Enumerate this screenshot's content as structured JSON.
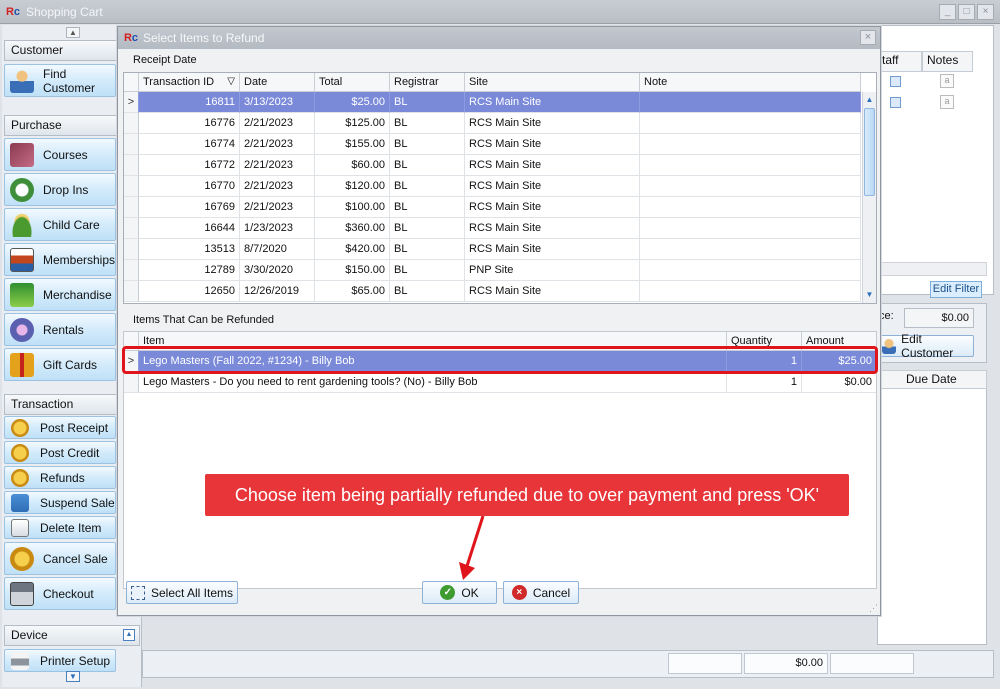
{
  "main": {
    "title": "Shopping Cart",
    "window_controls": [
      "_",
      "□",
      "×"
    ]
  },
  "sidebar": {
    "customer_header": "Customer",
    "find_customer": "Find Customer",
    "purchase_header": "Purchase",
    "purchase_items": [
      "Courses",
      "Drop Ins",
      "Child Care",
      "Memberships",
      "Merchandise",
      "Rentals",
      "Gift Cards"
    ],
    "transaction_header": "Transaction",
    "transaction_items": [
      "Post Receipt",
      "Post Credit",
      "Refunds",
      "Suspend Sale",
      "Delete Item"
    ],
    "cancel_sale": "Cancel Sale",
    "checkout": "Checkout",
    "device_header": "Device",
    "printer_setup": "Printer Setup"
  },
  "background": {
    "staff_header": "taff",
    "notes_header": "Notes",
    "edit_filter": "Edit Filter",
    "balance_label": "ce:",
    "balance_value": "$0.00",
    "edit_customer": "Edit Customer",
    "due_date_header": "Due Date",
    "status_total": "$0.00"
  },
  "dialog": {
    "title": "Select Items to Refund",
    "receipt_group_label": "Receipt Date",
    "receipt_columns": [
      "Transaction ID",
      "Date",
      "Total",
      "Registrar",
      "Site",
      "Note"
    ],
    "sort_indicator": "▽",
    "receipts": [
      {
        "id": "16811",
        "date": "3/13/2023",
        "total": "$25.00",
        "registrar": "BL",
        "site": "RCS Main Site",
        "note": ""
      },
      {
        "id": "16776",
        "date": "2/21/2023",
        "total": "$125.00",
        "registrar": "BL",
        "site": "RCS Main Site",
        "note": ""
      },
      {
        "id": "16774",
        "date": "2/21/2023",
        "total": "$155.00",
        "registrar": "BL",
        "site": "RCS Main Site",
        "note": ""
      },
      {
        "id": "16772",
        "date": "2/21/2023",
        "total": "$60.00",
        "registrar": "BL",
        "site": "RCS Main Site",
        "note": ""
      },
      {
        "id": "16770",
        "date": "2/21/2023",
        "total": "$120.00",
        "registrar": "BL",
        "site": "RCS Main Site",
        "note": ""
      },
      {
        "id": "16769",
        "date": "2/21/2023",
        "total": "$100.00",
        "registrar": "BL",
        "site": "RCS Main Site",
        "note": ""
      },
      {
        "id": "16644",
        "date": "1/23/2023",
        "total": "$360.00",
        "registrar": "BL",
        "site": "RCS Main Site",
        "note": ""
      },
      {
        "id": "13513",
        "date": "8/7/2020",
        "total": "$420.00",
        "registrar": "BL",
        "site": "RCS Main Site",
        "note": ""
      },
      {
        "id": "12789",
        "date": "3/30/2020",
        "total": "$150.00",
        "registrar": "BL",
        "site": "PNP Site",
        "note": ""
      },
      {
        "id": "12650",
        "date": "12/26/2019",
        "total": "$65.00",
        "registrar": "BL",
        "site": "RCS Main Site",
        "note": ""
      }
    ],
    "items_group_label": "Items That Can be Refunded",
    "item_columns": [
      "Item",
      "Quantity",
      "Amount"
    ],
    "items": [
      {
        "item": "Lego Masters (Fall 2022, #1234) - Billy Bob",
        "quantity": "1",
        "amount": "$25.00"
      },
      {
        "item": "Lego Masters - Do you need to rent gardening tools? (No) - Billy Bob",
        "quantity": "1",
        "amount": "$0.00"
      }
    ],
    "select_all_label": "Select All Items",
    "ok_label": "OK",
    "cancel_label": "Cancel"
  },
  "annotation": {
    "callout_text": "Choose item being partially refunded due to over payment and press 'OK'",
    "highlight_color": "#e0141b",
    "callout_color": "#e7353a"
  },
  "colors": {
    "selected_row": "#7a8ad9",
    "button_blue": "#bfe0f7"
  }
}
